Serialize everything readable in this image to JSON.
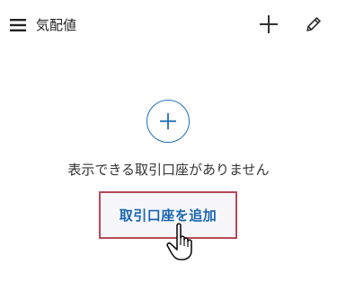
{
  "header": {
    "title": "気配値",
    "menu_icon": "hamburger-menu-icon",
    "add_icon": "plus-icon",
    "edit_icon": "pencil-icon"
  },
  "empty_state": {
    "add_icon": "circle-plus-icon",
    "message": "表示できる取引口座がありません",
    "button_label": "取引口座を追加"
  },
  "colors": {
    "accent": "#1a66b0",
    "button_border": "#b34b57",
    "text": "#333333",
    "background": "#ffffff"
  },
  "cursor": {
    "icon": "hand-pointer-cursor-icon"
  }
}
